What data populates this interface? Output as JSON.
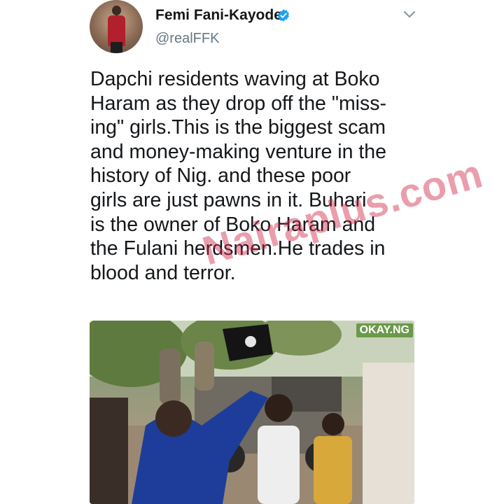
{
  "tweet": {
    "author_name": "Femi Fani-Kayode",
    "author_handle": "@realFFK",
    "text_lines": [
      "Dapchi residents waving at Boko",
      "Haram as they drop off the \"miss-",
      "ing\" girls.This is the biggest scam",
      "and money-making venture in the",
      "history of Nig. and these poor",
      "girls are just pawns in it. Buhari",
      "is the owner of Boko Haram and",
      "the Fulani herdsmen.He trades in",
      "blood and terror."
    ],
    "verified_icon": "verified-badge-icon",
    "menu_icon": "chevron-down-icon"
  },
  "watermark": "Nairaplus.com",
  "media": {
    "badge": "OKAY.NG"
  },
  "colors": {
    "verified": "#1da1f2",
    "handle": "#657786",
    "watermark": "#d02846"
  }
}
